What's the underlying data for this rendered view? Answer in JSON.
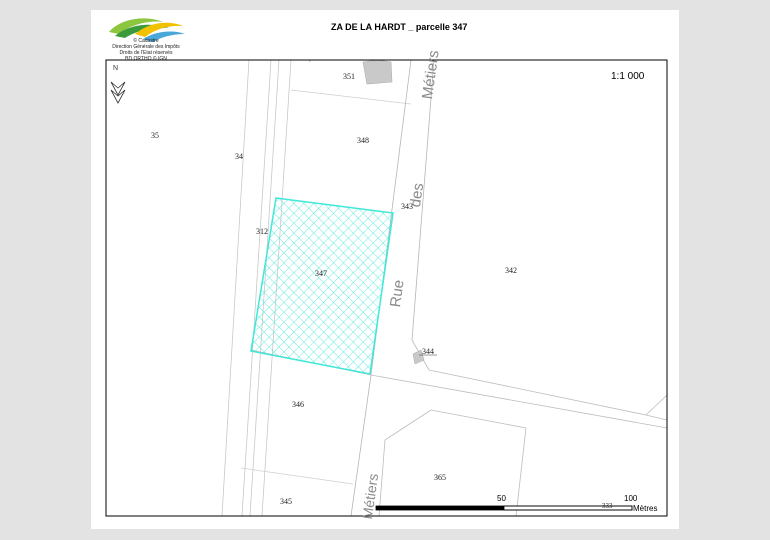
{
  "header": {
    "title": "ZA DE LA HARDT _ parcelle 347",
    "credits": [
      "© Cadastre",
      "Direction Générale des Impôts",
      "Droits de l'Etat réservés",
      "BD ORTHO © IGN"
    ]
  },
  "map": {
    "scale_ratio": "1:1 000",
    "north_letter": "N",
    "highlighted_parcel": "347",
    "highlight_color": "#3fe8d8",
    "parcels": {
      "p351": "351",
      "p35": "35",
      "p34": "34",
      "p348": "348",
      "p343": "343",
      "p312": "312",
      "p347": "347",
      "p342": "342",
      "p344": "344",
      "p346": "346",
      "p365": "365",
      "p345": "345",
      "p333": "333"
    },
    "street_labels": {
      "top": "Métiers",
      "des": "des",
      "rue": "Rue",
      "bottom": "Métiers"
    }
  },
  "scalebar": {
    "ticks": [
      "50",
      "100"
    ],
    "unit": "Mètres"
  }
}
